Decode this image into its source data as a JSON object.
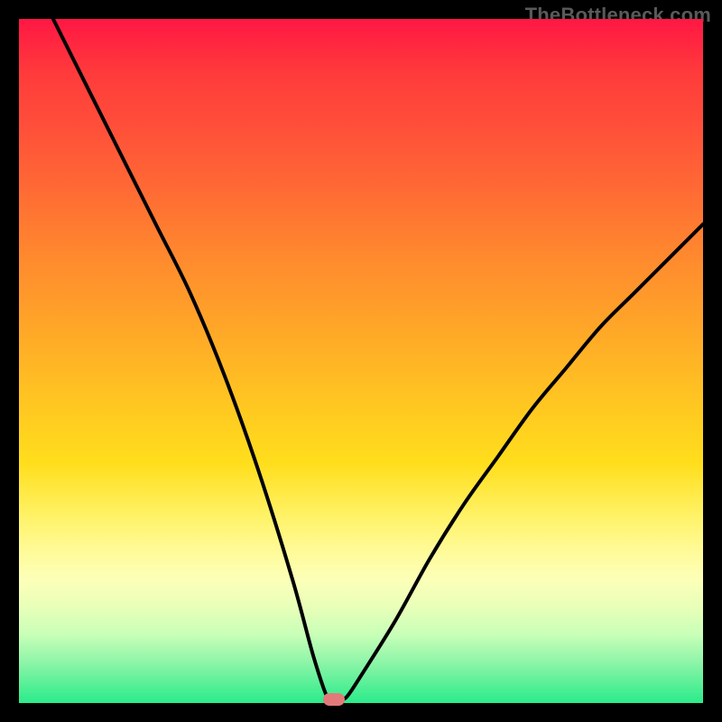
{
  "watermark": "TheBottleneck.com",
  "colors": {
    "frame_bg": "#000000",
    "curve_stroke": "#000000",
    "marker_fill": "#e37a7a",
    "gradient_top": "#ff1744",
    "gradient_bottom": "#2aeb8a"
  },
  "chart_data": {
    "type": "line",
    "title": "",
    "xlabel": "",
    "ylabel": "",
    "xlim": [
      0,
      100
    ],
    "ylim": [
      0,
      100
    ],
    "description": "Bottleneck curve: steep descending left branch and gentler ascending right branch meeting at a minimum near x≈46.",
    "minimum_marker": {
      "x": 46,
      "y": 0.5
    },
    "series": [
      {
        "name": "bottleneck-curve",
        "x": [
          5,
          10,
          15,
          20,
          25,
          30,
          35,
          40,
          43,
          45,
          46,
          47,
          48,
          50,
          55,
          60,
          65,
          70,
          75,
          80,
          85,
          90,
          95,
          100
        ],
        "values": [
          100,
          90,
          80,
          70,
          60,
          48,
          34,
          18,
          7,
          1,
          0.5,
          0.5,
          1,
          4,
          12,
          21,
          29,
          36,
          43,
          49,
          55,
          60,
          65,
          70
        ]
      }
    ]
  }
}
